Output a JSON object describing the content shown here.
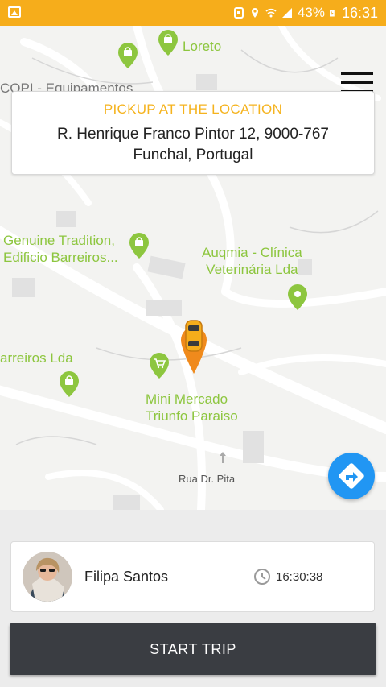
{
  "status_bar": {
    "battery": "43%",
    "time": "16:31",
    "icons": [
      "gallery-icon",
      "sim-icon",
      "location-icon",
      "wifi-icon",
      "signal-icon",
      "battery-charging-icon"
    ]
  },
  "map": {
    "pois": [
      {
        "name": "Loreto",
        "icon": "shopping-bag-pin-icon"
      },
      {
        "name": "COPI - Equipamentos",
        "icon": "shopping-bag-pin-icon"
      },
      {
        "name_lines": [
          "Genuine Tradition,",
          "Edificio Barreiros..."
        ],
        "icon": "shopping-bag-pin-icon"
      },
      {
        "name_lines": [
          "Auqmia - Clínica",
          "Veterinária Lda"
        ],
        "icon": "location-pin-icon"
      },
      {
        "name": "arreiros Lda",
        "icon": "shopping-bag-pin-icon"
      },
      {
        "name_lines": [
          "Mini Mercado",
          "Triunfo Paraiso"
        ],
        "icon": "cart-pin-icon"
      }
    ],
    "street": "Rua Dr. Pita",
    "vehicle_icon": "taxi-car-pin-icon",
    "accent_color": "#8dc63f"
  },
  "pickup": {
    "title": "PICKUP AT THE LOCATION",
    "address_line1": "R. Henrique Franco Pintor 12, 9000-767",
    "address_line2": "Funchal, Portugal"
  },
  "rider": {
    "name": "Filipa Santos",
    "time": "16:30:38"
  },
  "actions": {
    "start_trip": "START TRIP"
  },
  "colors": {
    "status_bar": "#f6ad1b",
    "pickup_title": "#f5b31e",
    "nav_button": "#2196f3",
    "start_button": "#3a3d42"
  }
}
